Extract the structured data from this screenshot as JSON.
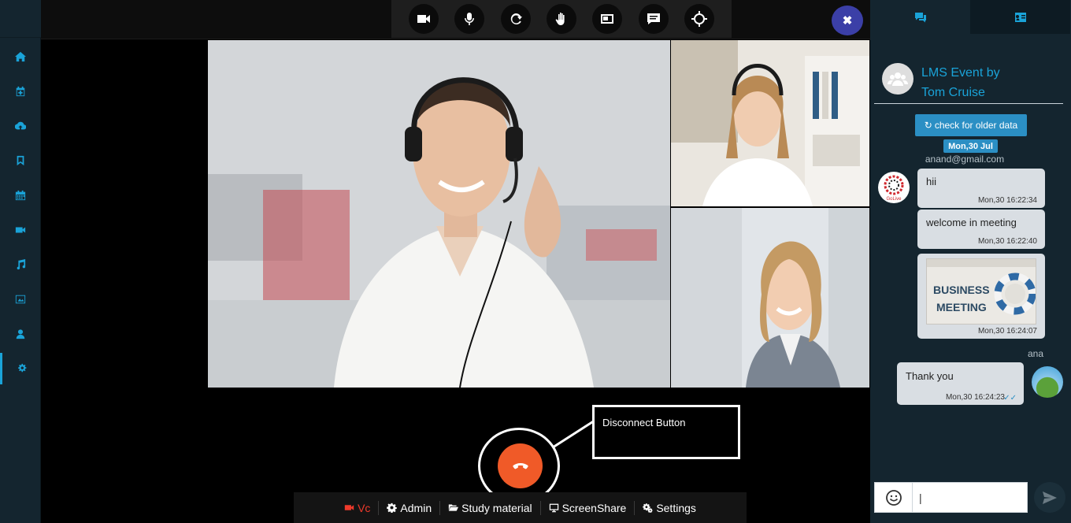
{
  "sidebar": {
    "items": [
      {
        "icon": "home-icon"
      },
      {
        "icon": "calendar-plus-icon"
      },
      {
        "icon": "cloud-upload-icon"
      },
      {
        "icon": "bookmark-icon"
      },
      {
        "icon": "calendar-icon"
      },
      {
        "icon": "video-icon"
      },
      {
        "icon": "music-icon"
      },
      {
        "icon": "image-icon"
      },
      {
        "icon": "user-icon"
      },
      {
        "icon": "cogs-icon",
        "active": true
      }
    ]
  },
  "toolbar": {
    "buttons": [
      "video-camera-icon",
      "microphone-icon",
      "refresh-icon",
      "raise-hand-icon",
      "picture-in-picture-icon",
      "chat-message-icon",
      "crosshair-icon"
    ]
  },
  "close_button": {
    "label": "✖"
  },
  "callout": {
    "label": "Disconnect Button"
  },
  "bottom_bar": {
    "items": [
      {
        "label": "Vc",
        "icon": "video-icon",
        "active": true
      },
      {
        "label": "Admin",
        "icon": "gear-icon"
      },
      {
        "label": "Study material",
        "icon": "folder-open-icon"
      },
      {
        "label": "ScreenShare",
        "icon": "monitor-icon"
      },
      {
        "label": "Settings",
        "icon": "cogs-icon"
      }
    ]
  },
  "chat": {
    "title_line1": "LMS Event by",
    "title_line2": "Tom Cruise",
    "older_button": "check for older data",
    "date_pill": "Mon,30 Jul",
    "sender_email": "anand@gmail.com",
    "golive_label": "GoLive",
    "messages": [
      {
        "text": "hii",
        "time": "Mon,30 16:22:34"
      },
      {
        "text": "welcome in meeting",
        "time": "Mon,30 16:22:40"
      },
      {
        "image_caption_line1": "BUSINESS",
        "image_caption_line2": "MEETING",
        "time": "Mon,30 16:24:07"
      },
      {
        "sender": "ana",
        "text": "Thank you",
        "time": "Mon,30 16:24:23"
      }
    ],
    "input_value": "|",
    "accent_color": "#1aa3d8"
  },
  "colors": {
    "sidebar_bg": "#14252f",
    "disconnect": "#f05a28",
    "close_button": "#3b3fa7",
    "active_tab_red": "#ef3a2b"
  }
}
